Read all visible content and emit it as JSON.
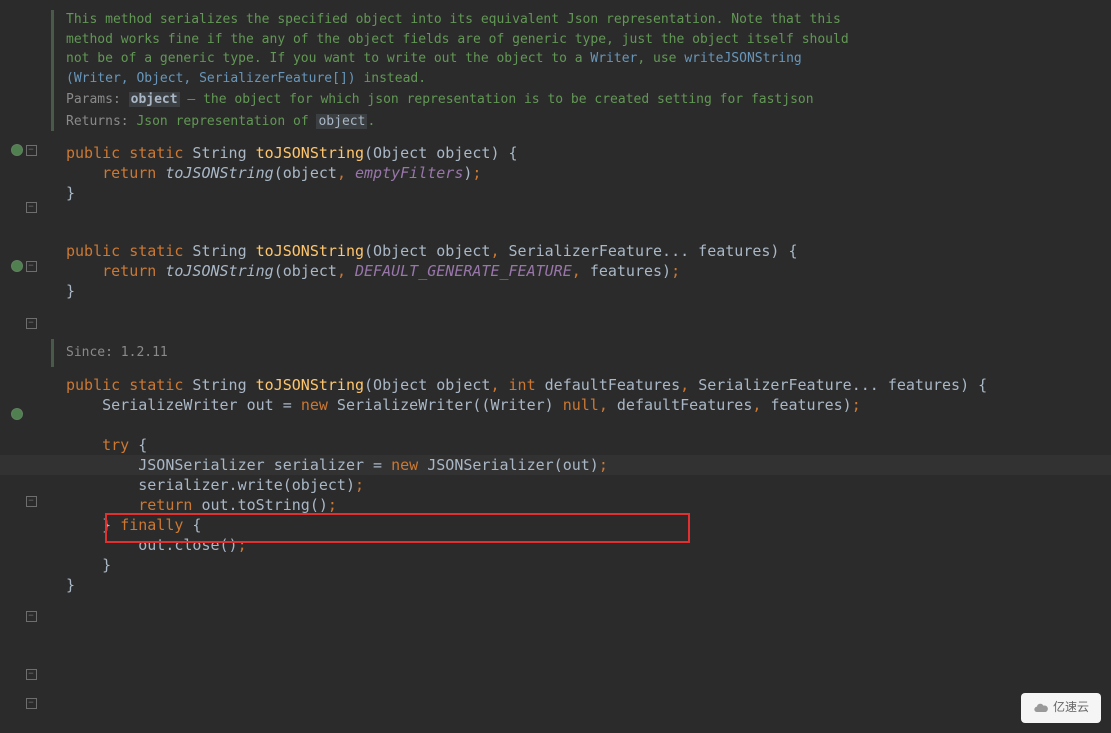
{
  "doc": {
    "description_l1": "This method serializes the specified object into its equivalent Json representation. Note that this",
    "description_l2": "method works fine if the any of the object fields are of generic type, just the object itself should",
    "description_l3": "not be of a generic type. If you want to write out the object to a ",
    "writer_link": "Writer",
    "use_text": ", use ",
    "method_link": "writeJSONString",
    "sig_open": "(",
    "sig_writer": "Writer",
    "sig_c1": ", ",
    "sig_object": "Object",
    "sig_c2": ", ",
    "sig_feature": "SerializerFeature[]",
    "sig_close": ")",
    "instead": " instead.",
    "params_label": "Params: ",
    "param_name": "object",
    "param_desc": " – the object for which json representation is to be created setting for fastjson",
    "returns_label": "Returns: ",
    "returns_pre": "Json representation of ",
    "returns_code": "object",
    "returns_post": "."
  },
  "method1": {
    "mods": "public static",
    "ret": " String ",
    "name": "toJSONString",
    "sig_open": "(Object object) {",
    "return_kw": "return",
    "call": " toJSONString",
    "args_open": "(object",
    "comma": ", ",
    "filters": "emptyFilters",
    "args_close": ")",
    "semi": ";",
    "close": "}"
  },
  "method2": {
    "mods": "public static",
    "ret": " String ",
    "name": "toJSONString",
    "sig_open": "(Object object",
    "comma1": ", ",
    "feat_type": "SerializerFeature... features) {",
    "return_kw": "return",
    "call": " toJSONString",
    "args_open": "(object",
    "comma2": ", ",
    "default_feat": "DEFAULT_GENERATE_FEATURE",
    "comma3": ", ",
    "features": "features)",
    "semi": ";",
    "close": "}"
  },
  "since": {
    "label": "Since: ",
    "value": "1.2.11"
  },
  "method3": {
    "mods": "public static",
    "ret": " String ",
    "name": "toJSONString",
    "sig_open": "(Object object",
    "c1": ", ",
    "int_kw": "int",
    "df": " defaultFeatures",
    "c2": ", ",
    "feat": "SerializerFeature... features) {",
    "l2_pre": "SerializeWriter out = ",
    "new1": "new",
    "l2_call": " SerializeWriter((Writer) ",
    "null_kw": "null",
    "l2_c1": ", ",
    "l2_df": "defaultFeatures",
    "l2_c2": ", ",
    "l2_f": "features)",
    "semi1": ";",
    "try_kw": "try",
    "try_open": " {",
    "ser_pre": "JSONSerializer serializer = ",
    "new2": "new",
    "ser_call": " JSONSerializer(out)",
    "semi2": ";",
    "write": "serializer.write(object)",
    "semi3": ";",
    "return_kw": "return",
    "ret_call": " out.toString()",
    "semi4": ";",
    "try_close": "} ",
    "finally_kw": "finally",
    "finally_open": " {",
    "close_call": "out.close()",
    "semi5": ";",
    "finally_close": "}",
    "close": "}"
  },
  "watermark": "亿速云"
}
